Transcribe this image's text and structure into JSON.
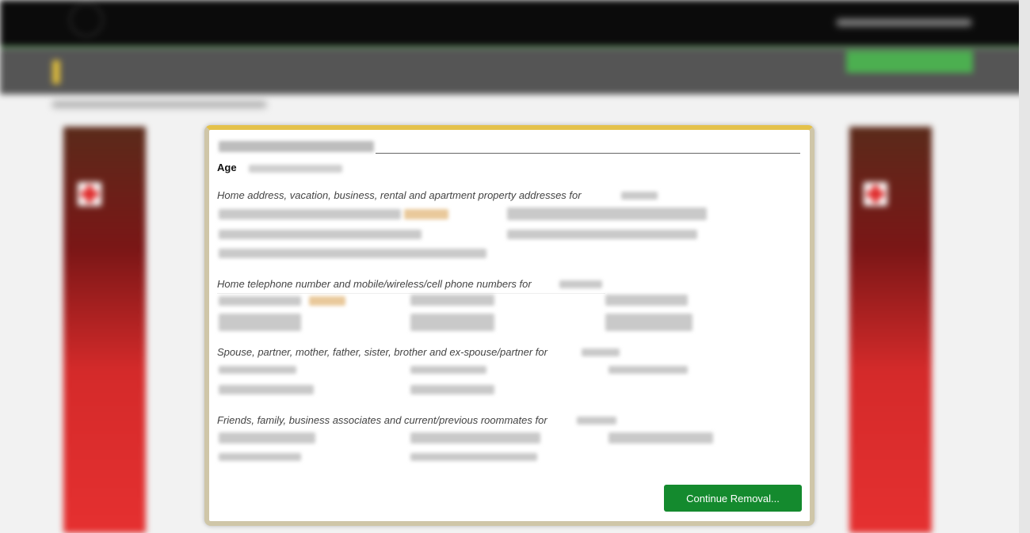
{
  "modal": {
    "age_label": "Age",
    "sections": {
      "addresses_label": "Home address, vacation, business, rental and apartment property addresses for",
      "phones_label": "Home telephone number and mobile/wireless/cell phone numbers for",
      "relatives_label": "Spouse, partner, mother, father, sister, brother and ex-spouse/partner for",
      "associates_label": "Friends, family, business associates and current/previous roommates for"
    },
    "continue_label": "Continue Removal..."
  },
  "colors": {
    "continue_button": "#148a2e",
    "modal_border_top": "#e4c14a",
    "topbar": "#0b0b0b",
    "headerbar": "#555555"
  },
  "icons": {
    "search": "search-icon",
    "cross": "red-cross-icon"
  }
}
